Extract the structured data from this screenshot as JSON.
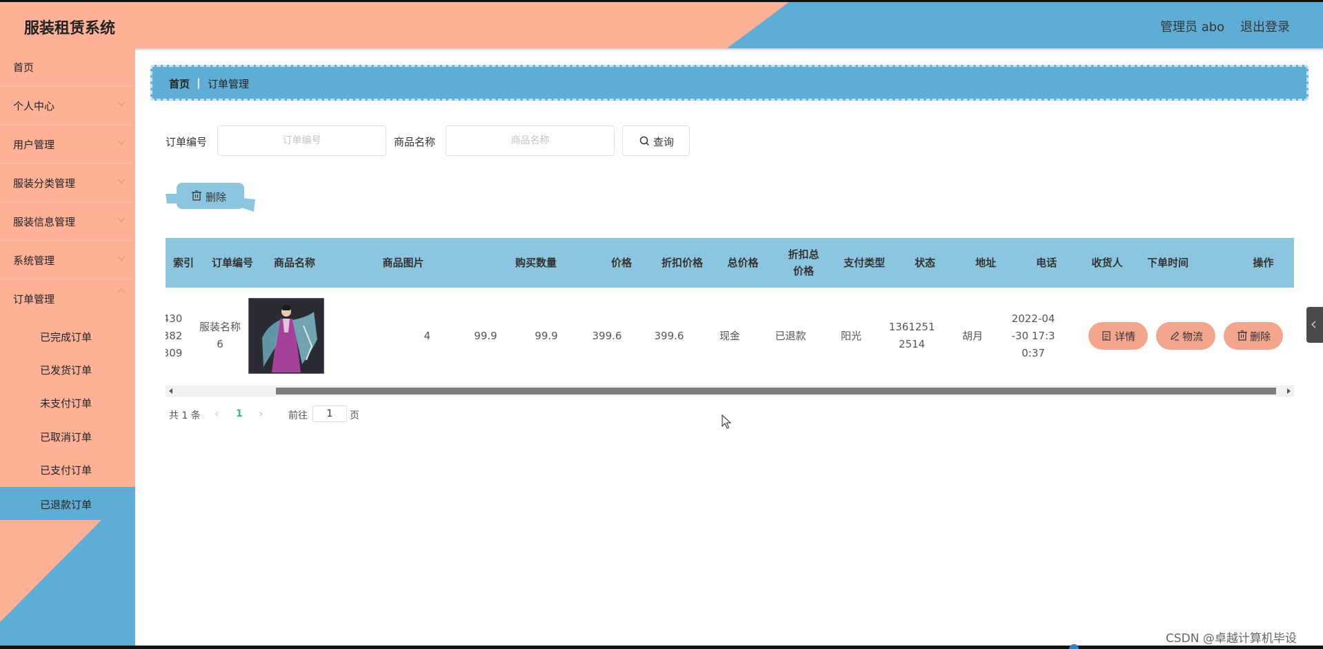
{
  "header": {
    "title": "服装租赁系统",
    "admin": "管理员 abo",
    "logout": "退出登录"
  },
  "sidebar": {
    "items": [
      {
        "label": "首页"
      },
      {
        "label": "个人中心"
      },
      {
        "label": "用户管理"
      },
      {
        "label": "服装分类管理"
      },
      {
        "label": "服装信息管理"
      },
      {
        "label": "系统管理"
      },
      {
        "label": "订单管理"
      }
    ],
    "sub_items": [
      {
        "label": "已完成订单"
      },
      {
        "label": "已发货订单"
      },
      {
        "label": "未支付订单"
      },
      {
        "label": "已取消订单"
      },
      {
        "label": "已支付订单"
      },
      {
        "label": "已退款订单",
        "active": true
      }
    ]
  },
  "breadcrumb": {
    "home": "首页",
    "separator": "|",
    "current": "订单管理"
  },
  "search": {
    "order_no_label": "订单编号",
    "order_no_placeholder": "订单编号",
    "product_name_label": "商品名称",
    "product_name_placeholder": "商品名称",
    "query_button": "查询"
  },
  "actions": {
    "delete_button": "删除"
  },
  "table": {
    "columns": [
      "索引",
      "订单编号",
      "商品名称",
      "商品图片",
      "购买数量",
      "价格",
      "折扣价格",
      "总价格",
      "折扣总价格",
      "支付类型",
      "状态",
      "地址",
      "电话",
      "收货人",
      "下单时间",
      "操作"
    ],
    "rows": [
      {
        "order_no": "430\n382\n309",
        "product_name": "服装名称\n6",
        "quantity": "4",
        "price": "99.9",
        "discount_price": "99.9",
        "total_price": "399.6",
        "discount_total": "399.6",
        "payment_type": "现金",
        "status": "已退款",
        "address": "阳光",
        "phone": "1361251\n2514",
        "receiver": "胡月",
        "order_time": "2022-04\n-30 17:3\n0:37",
        "ops": {
          "detail": "详情",
          "logistics": "物流",
          "delete": "删除"
        }
      }
    ]
  },
  "pagination": {
    "total": "共 1 条",
    "current": "1",
    "goto_label": "前往",
    "goto_value": "1",
    "page_label": "页"
  },
  "watermark": "CSDN @卓越计算机毕设",
  "colors": {
    "salmon": "#fdb197",
    "blue": "#5fadd4",
    "light_blue": "#8cc5df",
    "op_button": "#f4a58e"
  }
}
